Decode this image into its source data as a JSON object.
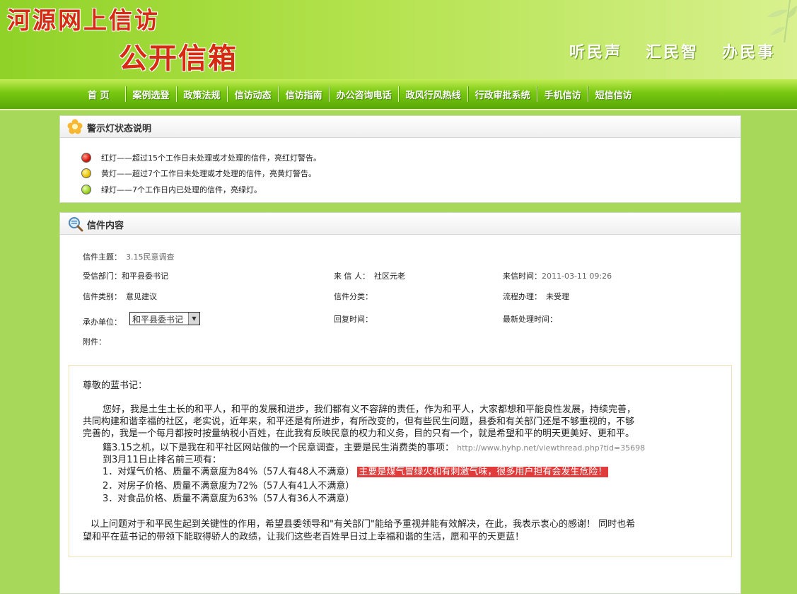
{
  "header": {
    "title": "河源网上信访",
    "subtitle": "公开信箱",
    "slogans": [
      "听民声",
      "汇民智",
      "办民事"
    ]
  },
  "nav": {
    "items": [
      "首 页",
      "案例选登",
      "政策法规",
      "信访动态",
      "信访指南",
      "办公咨询电话",
      "政风行风热线",
      "行政审批系统",
      "手机信访",
      "短信信访"
    ]
  },
  "legend_panel": {
    "title": "警示灯状态说明",
    "items": [
      {
        "color": "red",
        "text": "红灯——超过15个工作日未处理或才处理的信件，亮红灯警告。"
      },
      {
        "color": "yellow",
        "text": "黄灯——超过7个工作日未处理或才处理的信件，亮黄灯警告。"
      },
      {
        "color": "green",
        "text": "绿灯——7个工作日内已处理的信件，亮绿灯。"
      }
    ]
  },
  "letter_panel": {
    "title": "信件内容",
    "subject_label": "信件主题：",
    "subject_value": "3.15民意调查",
    "dept_label": "受信部门：",
    "dept_value": "和平县委书记",
    "sender_label": "来 信 人：",
    "sender_value": "社区元老",
    "time_label": "来信时间：",
    "time_value": "2011-03-11 09:26",
    "category_label": "信件类别：",
    "category_value": "意见建议",
    "class_label": "信件分类：",
    "class_value": "",
    "process_label": "流程办理：",
    "process_value": "未受理",
    "unit_label": "承办单位：",
    "unit_selected": "和平县委书记",
    "reply_label": "回复时间：",
    "reply_value": "",
    "latest_label": "最新处理时间：",
    "latest_value": "",
    "attachment_label": "附件：",
    "letter": {
      "greeting": "尊敬的蓝书记：",
      "para1_line1": "您好，我是土生土长的和平人，和平的发展和进步，我们都有义不容辞的责任，作为和平人，大家都想和平能良性发展，持续完善，",
      "para1_line2": "共同构建和谐幸福的社区，老实说，近年来，和平还是有所进步，有所改变的，但有些民生问题，县委和有关部门还是不够重视的，不够",
      "para1_line3": "完善的，我是一个每月都按时按量纳税小百姓，在此我有反映民意的权力和义务，目的只有一个，就是希望和平的明天更美好、更和平。",
      "para2_text": "籍3.15之机，以下是我在和平社区网站做的一个民意调查，主要是民生消费类的事项：",
      "para2_url": "http://www.hyhp.net/viewthread.php?tid=35698",
      "para3": "到3月11日止排名前三项有：",
      "item1": "1．对煤气价格、质量不满意度为84%（57人有48人不满意）",
      "item1_highlight": "主要是煤气冒绿火和有刺激气味，很多用户担有会发生危险！",
      "item2": "2．对房子价格、质量不满意度为72%（57人有41人不满意）",
      "item3": "3．对食品价格、质量不满意度为63%（57人有36人不满意）",
      "para4_line1": "以上问题对于和平民生起到关键性的作用，希望县委领导和\"有关部门\"能给予重视并能有效解决，在此，我表示衷心的感谢！ 同时也希",
      "para4_line2": "望和平在蓝书记的带领下能取得骄人的政绩，让我们这些老百姓早日过上幸福和谐的生活，愿和平的天更蓝！"
    }
  }
}
